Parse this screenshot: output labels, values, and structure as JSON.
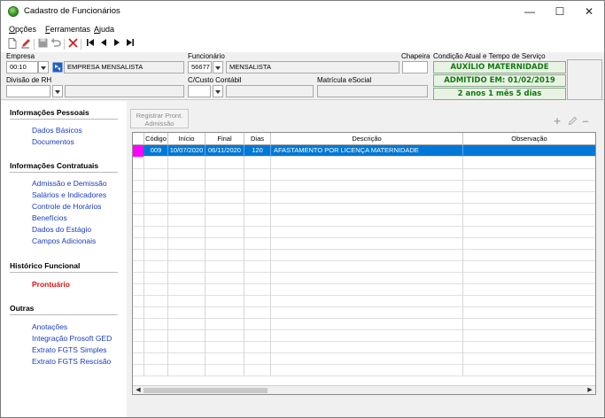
{
  "window": {
    "title": "Cadastro de Funcionários"
  },
  "menu": [
    "Opções",
    "Ferramentas",
    "Ajuda"
  ],
  "toolbar": {
    "icons": [
      "new-icon",
      "edit-icon",
      "save-icon",
      "undo-icon",
      "delete-icon",
      "first-icon",
      "prev-icon",
      "next-icon",
      "last-icon"
    ]
  },
  "header": {
    "empresa": {
      "label": "Empresa",
      "code": "00:10",
      "name": "EMPRESA MENSALISTA"
    },
    "funcionario": {
      "label": "Funcionário",
      "code": "56677",
      "name": "MENSALISTA"
    },
    "chapeira": {
      "label": "Chapeira",
      "value": ""
    },
    "condicao": {
      "label": "Condição Atual e Tempo de Serviço",
      "status": "AUXÍLIO MATERNIDADE",
      "admissao": "ADMITIDO EM: 01/02/2019",
      "tempo": "2 anos 1 mês 5 dias"
    },
    "divisao": {
      "label": "Divisão de RH",
      "value": ""
    },
    "custo": {
      "label": "C/Custo Contábil",
      "value": ""
    },
    "matricula": {
      "label": "Matrícula eSocial",
      "value": ""
    }
  },
  "sidebar": {
    "sections": [
      {
        "title": "Informações Pessoais",
        "links": [
          "Dados Básicos",
          "Documentos"
        ]
      },
      {
        "title": "Informações Contratuais",
        "links": [
          "Admissão e Demissão",
          "Salários e Indicadores",
          "Controle de Horários",
          "Benefícios",
          "Dados do Estágio",
          "Campos Adicionais"
        ]
      },
      {
        "title": "Histórico Funcional",
        "links": [
          "Prontuário"
        ]
      },
      {
        "title": "Outras",
        "links": [
          "Anotações",
          "Integração Prosoft GED",
          "Extrato FGTS Simples",
          "Extrato FGTS Rescisão"
        ]
      }
    ],
    "active": "Prontuário"
  },
  "main": {
    "register_button": "Registrar Pront. Admissão",
    "actions": [
      "add-icon",
      "edit-icon",
      "remove-icon"
    ],
    "columns": [
      "Código",
      "Início",
      "Final",
      "Dias",
      "Descrição",
      "Observação"
    ],
    "rows": [
      {
        "codigo": "009",
        "inicio": "10/07/2020",
        "final": "06/11/2020",
        "dias": "120",
        "descricao": "AFASTAMENTO POR LICENÇA MATERNIDADE",
        "observacao": ""
      }
    ]
  },
  "colors": {
    "accent_selection": "#0078d7",
    "status_green": "#0f7a0f",
    "link_blue": "#1a3cc0",
    "active_red": "#e01010",
    "row_indicator": "#ff00ff"
  }
}
